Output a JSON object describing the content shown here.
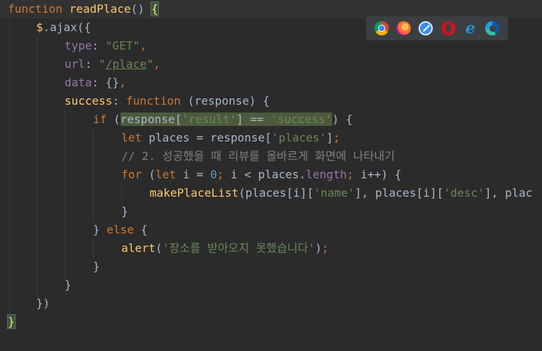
{
  "editor": {
    "line1": {
      "kw": "function",
      "name": "readPlace",
      "rest": "() ",
      "brace": "{"
    },
    "line2": {
      "dollar": "$",
      "call": ".ajax({"
    },
    "line3": {
      "key": "type",
      "sep": ": ",
      "val": "\"GET\"",
      "end": ","
    },
    "line4": {
      "key": "url",
      "sep": ": ",
      "q1": "\"",
      "link": "/place",
      "q2": "\"",
      "end": ","
    },
    "line5": {
      "key": "data",
      "sep": ": {}",
      "end": ","
    },
    "line6": {
      "key": "success",
      "sep": ": ",
      "kw": "function",
      "rest": " (response) {"
    },
    "line7": {
      "kw": "if",
      "open": " (",
      "a": "response[",
      "s1": "'result'",
      "b": "] == ",
      "s2": "'success'",
      "close": ") {"
    },
    "line8": {
      "kw": "let",
      "a": " places = response[",
      "s": "'places'",
      "b": "]",
      "semi": ";"
    },
    "line9": {
      "comment": "// 2. 성공했을 때 리뷰를 올바르게 화면에 나타내기"
    },
    "line10": {
      "kw1": "for",
      "a": " (",
      "kw2": "let",
      "b": " i = ",
      "n": "0",
      "semi1": ";",
      "c": " i < places.",
      "prop": "length",
      "semi2": ";",
      "d": " i++) {"
    },
    "line11": {
      "fn": "makePlaceList",
      "a": "(places[i][",
      "s1": "'name'",
      "b": "], places[i][",
      "s2": "'desc'",
      "c": "], plac"
    },
    "line12": {
      "text": "}"
    },
    "line13": {
      "a": "} ",
      "kw": "else",
      "b": " {"
    },
    "line14": {
      "fn": "alert",
      "a": "(",
      "s": "'장소를 받아오지 못했습니다'",
      "b": ")",
      "semi": ";"
    },
    "line15": {
      "text": "}"
    },
    "line16": {
      "text": "}"
    },
    "line17": {
      "text": "})"
    },
    "line18": {
      "text": "}"
    }
  },
  "browsers": [
    "chrome-icon",
    "firefox-icon",
    "safari-icon",
    "opera-icon",
    "ie-icon",
    "edge-icon"
  ],
  "colors": {
    "background": "#2b2b2b",
    "keyword": "#cc7832",
    "function": "#ffc66d",
    "string": "#6a8759",
    "property": "#9876aa",
    "number": "#6897bb",
    "comment": "#808080",
    "text": "#a9b7c6"
  }
}
